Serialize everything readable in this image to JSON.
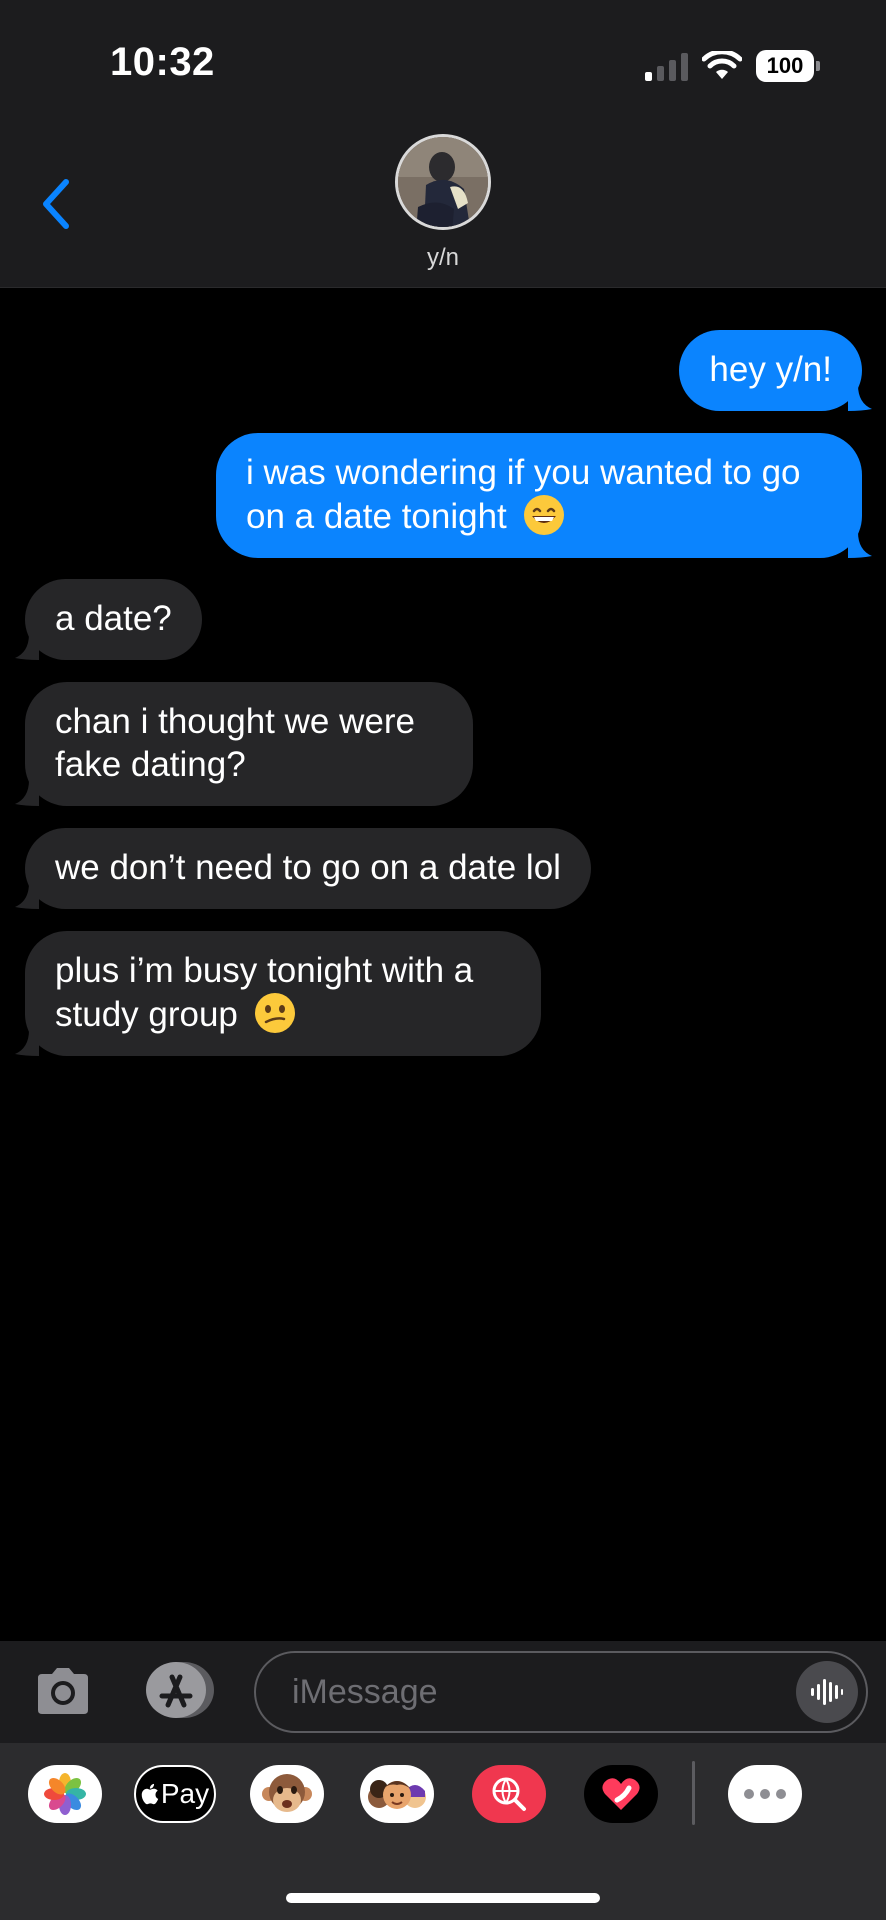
{
  "status_bar": {
    "time": "10:32",
    "battery": "100"
  },
  "contact": {
    "name": "y/n"
  },
  "messages": [
    {
      "direction": "sent",
      "text": "hey y/n!"
    },
    {
      "direction": "sent",
      "text": "i was wondering if you wanted to go on a date tonight"
    },
    {
      "direction": "received",
      "text": "a date?"
    },
    {
      "direction": "received",
      "text": "chan i thought we were fake dating?"
    },
    {
      "direction": "received",
      "text": "we don’t need to go on a date lol"
    },
    {
      "direction": "received",
      "text": "plus i’m busy tonight with a study group"
    }
  ],
  "input": {
    "placeholder": "iMessage"
  },
  "apps": [
    "photos-app",
    "apple-pay-app",
    "animoji-app",
    "memoji-app",
    "image-search-app",
    "digital-touch-app",
    "more-apps"
  ],
  "apple_pay_label": "Pay",
  "colors": {
    "sent_bubble": "#0b84fe",
    "received_bubble": "#262628",
    "accent": "#0a84ff"
  }
}
